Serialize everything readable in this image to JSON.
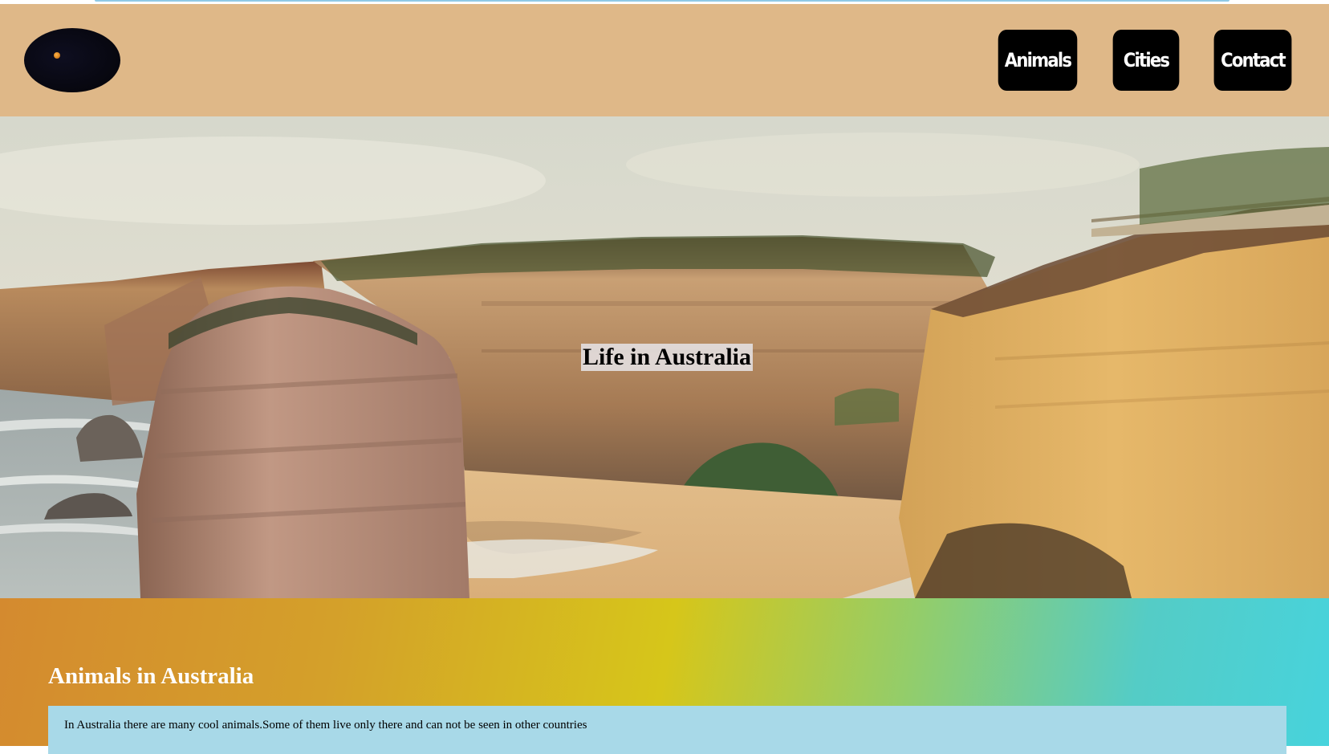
{
  "nav": {
    "items": [
      {
        "label": "Animals"
      },
      {
        "label": "Cities"
      },
      {
        "label": "Contact"
      }
    ]
  },
  "hero": {
    "title": "Life in Australia"
  },
  "animals_section": {
    "title": "Animals in Australia",
    "text": "In Australia there are many cool animals.Some of them live only there and can not be seen in other countries"
  },
  "colors": {
    "header_bg": "#dfb888",
    "nav_button_bg": "#000000",
    "section_text_box": "#a8d9e8",
    "gradient": [
      "#d48a2f",
      "#d6c61a",
      "#47d3dc"
    ]
  },
  "icons": {
    "logo": "dark-oval-logo"
  }
}
